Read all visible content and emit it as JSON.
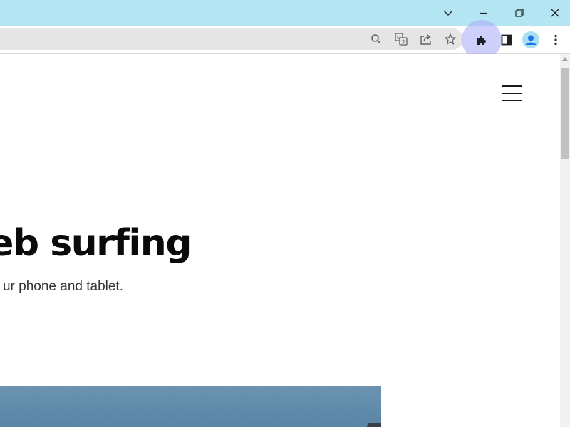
{
  "window": {
    "controls": [
      "tab-search",
      "minimize",
      "restore",
      "close"
    ]
  },
  "toolbar": {
    "omnibox_icons": [
      "search-icon",
      "translate-icon",
      "share-icon",
      "bookmark-star-icon"
    ],
    "icons": [
      "extensions-puzzle-icon",
      "side-panel-icon",
      "profile-avatar-icon",
      "more-vertical-icon"
    ],
    "accent": "#1a73e8",
    "highlight": "#a8a8f8"
  },
  "page": {
    "hero_title": "web surfing",
    "hero_subtitle": "ur phone and tablet.",
    "menu_icon": "hamburger-menu-icon",
    "hero_image_color": "#6289a9"
  },
  "colors": {
    "titlebar": "#b3e6f2",
    "omnibox": "#e5e5e5",
    "text": "#0a0a0a"
  }
}
